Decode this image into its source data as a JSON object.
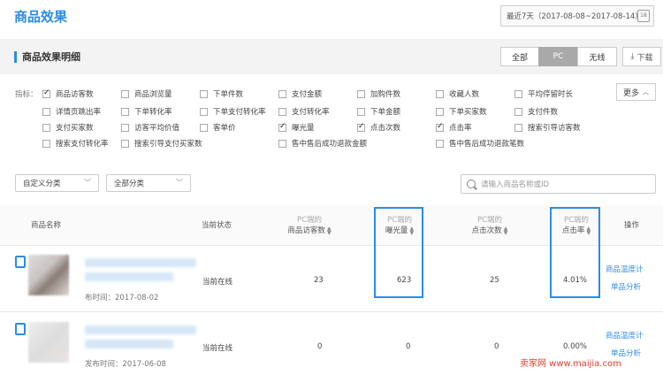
{
  "header": {
    "title": "商品效果",
    "date_range": "最近7天（2017-08-08~2017-08-14）",
    "calendar_icon": "calendar-icon"
  },
  "section": {
    "title": "商品效果明细",
    "segments": [
      {
        "label": "全部"
      },
      {
        "label": "PC"
      },
      {
        "label": "无线"
      }
    ],
    "active_segment": "PC",
    "download_label": "下载"
  },
  "metrics": {
    "label": "指标：",
    "more_label": "更多",
    "items": [
      {
        "label": "商品访客数",
        "checked": true
      },
      {
        "label": "商品浏览量",
        "checked": false
      },
      {
        "label": "下单件数",
        "checked": false
      },
      {
        "label": "支付金额",
        "checked": false
      },
      {
        "label": "加购件数",
        "checked": false
      },
      {
        "label": "收藏人数",
        "checked": false
      },
      {
        "label": "平均停留时长",
        "checked": false
      },
      {
        "label": "详情页跳出率",
        "checked": false
      },
      {
        "label": "下单转化率",
        "checked": false
      },
      {
        "label": "下单支付转化率",
        "checked": false
      },
      {
        "label": "支付转化率",
        "checked": false
      },
      {
        "label": "下单金额",
        "checked": false
      },
      {
        "label": "下单买家数",
        "checked": false
      },
      {
        "label": "支付件数",
        "checked": false
      },
      {
        "label": "支付买家数",
        "checked": false
      },
      {
        "label": "访客平均价值",
        "checked": false
      },
      {
        "label": "客单价",
        "checked": false
      },
      {
        "label": "曝光量",
        "checked": true
      },
      {
        "label": "点击次数",
        "checked": true
      },
      {
        "label": "点击率",
        "checked": true
      },
      {
        "label": "搜索引导访客数",
        "checked": false
      },
      {
        "label": "搜索支付转化率",
        "checked": false
      },
      {
        "label": "搜索引导支付买家数",
        "checked": false
      },
      {
        "label": "售中售后成功退款金额",
        "checked": false
      },
      {
        "label": "售中售后成功退款笔数",
        "checked": false
      }
    ]
  },
  "filters": {
    "custom_category": "自定义分类",
    "all_category": "全部分类",
    "search_placeholder": "请输入商品名称或ID"
  },
  "table": {
    "columns": {
      "name": "商品名称",
      "status": "当前状态",
      "prefix": "PC端的",
      "visitors": "商品访客数",
      "exposure": "曝光量",
      "clicks": "点击次数",
      "ctr": "点击率",
      "action": "操作"
    },
    "rows": [
      {
        "publish": "布时间：2017-08-02",
        "status": "当前在线",
        "visitors": "23",
        "exposure": "623",
        "clicks": "25",
        "ctr": "4.01%",
        "action1": "商品温度计",
        "action2": "单品分析"
      },
      {
        "publish": "发布时间：2017-06-08",
        "status": "当前在线",
        "visitors": "0",
        "exposure": "0",
        "clicks": "0",
        "ctr": "0.00%",
        "action1": "商品温度计",
        "action2": "单品分析"
      }
    ]
  },
  "watermark": "卖家网 www.maijia.com"
}
